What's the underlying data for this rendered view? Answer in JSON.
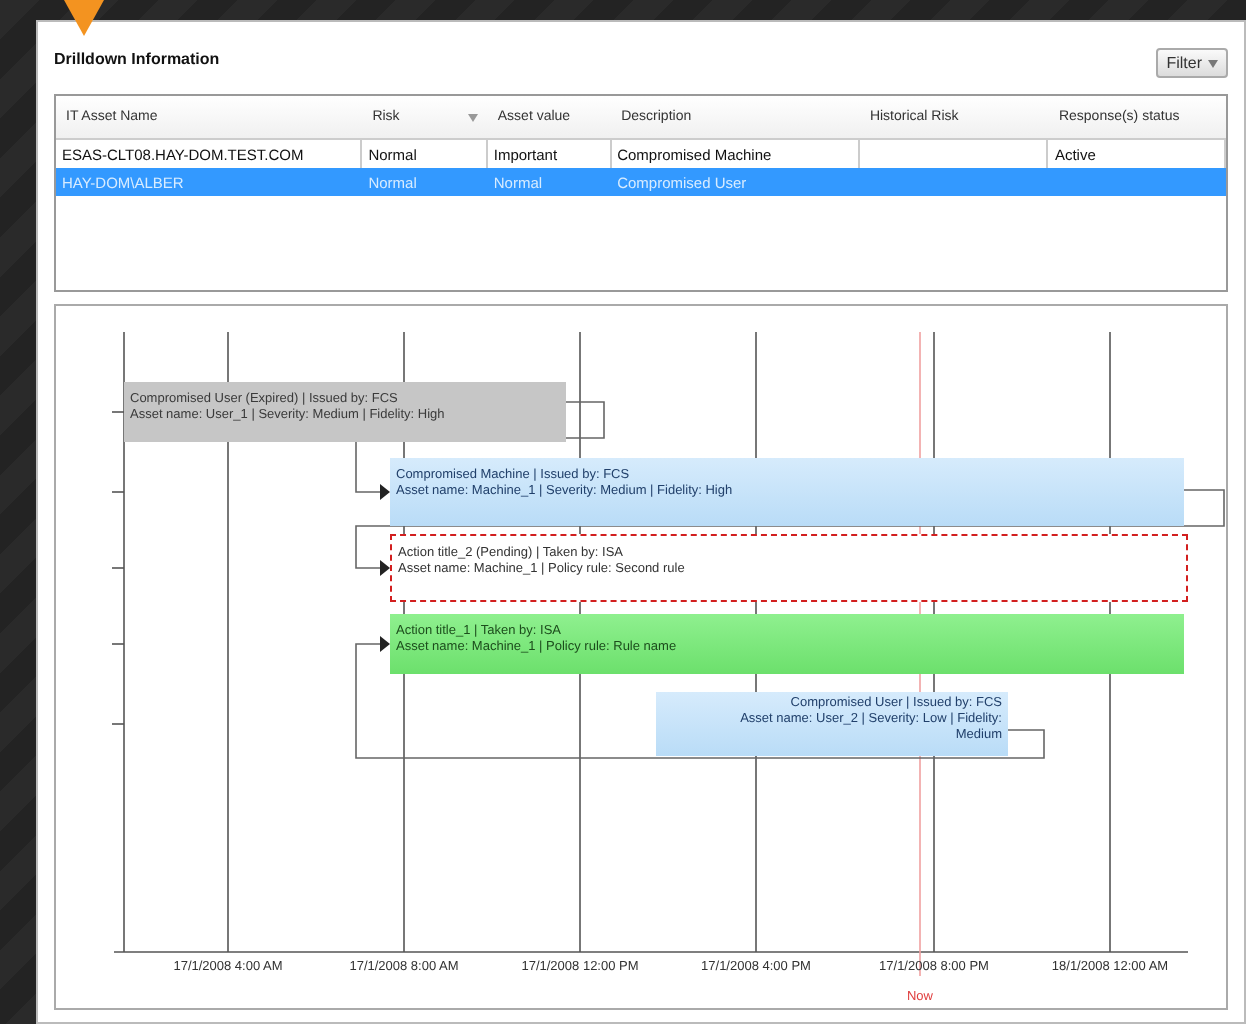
{
  "panel": {
    "title": "Drilldown Information",
    "filter_button": "Filter"
  },
  "table": {
    "columns": [
      "IT Asset Name",
      "Risk",
      "Asset value",
      "Description",
      "Historical Risk",
      "Response(s) status"
    ],
    "rows": [
      {
        "cells": [
          "ESAS-CLT08.HAY-DOM.TEST.COM",
          "Normal",
          "Important",
          "Compromised Machine",
          "",
          "Active"
        ],
        "selected": false
      },
      {
        "cells": [
          "HAY-DOM\\ALBER",
          "Normal",
          "Normal",
          "Compromised User",
          "",
          ""
        ],
        "selected": true
      }
    ]
  },
  "timeline": {
    "events": [
      {
        "kind": "expired",
        "lines": [
          "Compromised User (Expired) | Issued by: FCS",
          "Asset name: User_1 | Severity: Medium | Fidelity: High"
        ]
      },
      {
        "kind": "alert",
        "lines": [
          "Compromised Machine | Issued by: FCS",
          "Asset name: Machine_1 | Severity: Medium | Fidelity: High"
        ]
      },
      {
        "kind": "pending",
        "lines": [
          "Action title_2 (Pending) | Taken by: ISA",
          "Asset name: Machine_1 | Policy rule: Second rule"
        ]
      },
      {
        "kind": "action",
        "lines": [
          "Action title_1 | Taken by: ISA",
          "Asset name: Machine_1 | Policy rule: Rule name"
        ]
      },
      {
        "kind": "alert",
        "lines": [
          "Compromised User | Issued by: FCS",
          "Asset name: User_2 | Severity: Low | Fidelity:",
          "Medium"
        ]
      }
    ],
    "axis_labels": [
      "17/1/2008 4:00 AM",
      "17/1/2008 8:00 AM",
      "17/1/2008 12:00 PM",
      "17/1/2008 4:00 PM",
      "17/1/2008 8:00 PM",
      "18/1/2008 12:00 AM"
    ],
    "now_label": "Now"
  }
}
